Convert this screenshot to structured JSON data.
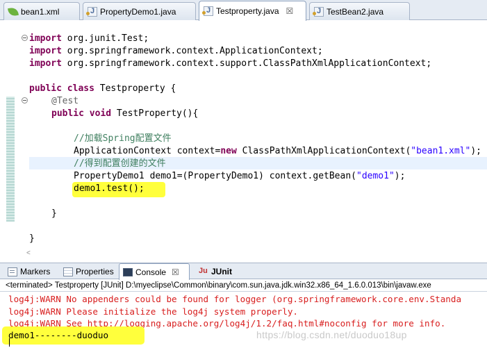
{
  "editor_tabs": [
    {
      "label": "bean1.xml",
      "icon": "spring-leaf-icon"
    },
    {
      "label": "PropertyDemo1.java",
      "icon": "java-file-icon"
    },
    {
      "label": "Testproperty.java",
      "icon": "java-file-icon",
      "close": "☒",
      "active": true
    },
    {
      "label": "TestBean2.java",
      "icon": "java-file-icon"
    }
  ],
  "code": {
    "imports": [
      {
        "kw": "import",
        "rest": " org.junit.Test;"
      },
      {
        "kw": "import",
        "rest": " org.springframework.context.ApplicationContext;"
      },
      {
        "kw": "import",
        "rest": " org.springframework.context.support.ClassPathXmlApplicationContext;"
      }
    ],
    "class_decl": {
      "kw1": "public",
      "kw2": "class",
      "name": " Testproperty {"
    },
    "annotation": "@Test",
    "method_decl": {
      "kw1": "public",
      "kw2": "void",
      "rest": " TestProperty(){"
    },
    "comment1": "//加载Spring配置文件",
    "ctx_line": {
      "a": "ApplicationContext context=",
      "kw": "new",
      "b": " ClassPathXmlApplicationContext(",
      "str": "\"bean1.xml\"",
      "c": ");"
    },
    "comment2": "//得到配置创建的文件",
    "bean_line": {
      "a": "PropertyDemo1 demo1=(PropertyDemo1) context.getBean(",
      "str": "\"demo1\"",
      "c": ");"
    },
    "call_line": "demo1.test();",
    "close_method": "}",
    "close_class": "}",
    "scroll_hint": "<"
  },
  "view_tabs": [
    {
      "label": "Markers",
      "icon": "markers-icon"
    },
    {
      "label": "Properties",
      "icon": "properties-icon"
    },
    {
      "label": "Console",
      "icon": "console-icon",
      "close": "☒",
      "active": true
    },
    {
      "label": "JUnit",
      "icon": "junit-icon"
    }
  ],
  "console": {
    "header": "<terminated> Testproperty [JUnit] D:\\myeclipse\\Common\\binary\\com.sun.java.jdk.win32.x86_64_1.6.0.013\\bin\\javaw.exe",
    "lines": [
      "log4j:WARN No appenders could be found for logger (org.springframework.core.env.Standa",
      "log4j:WARN Please initialize the log4j system properly.",
      "log4j:WARN See http://logging.apache.org/log4j/1.2/faq.html#noconfig for more info."
    ],
    "output": "demo1--------duoduo"
  },
  "watermark": "https://blog.csdn.net/duoduo18up",
  "colors": {
    "keyword": "#7f0055",
    "comment": "#3f7f5f",
    "string": "#2a00ff",
    "warn": "#d81e1e",
    "highlight": "#ffff3c"
  }
}
